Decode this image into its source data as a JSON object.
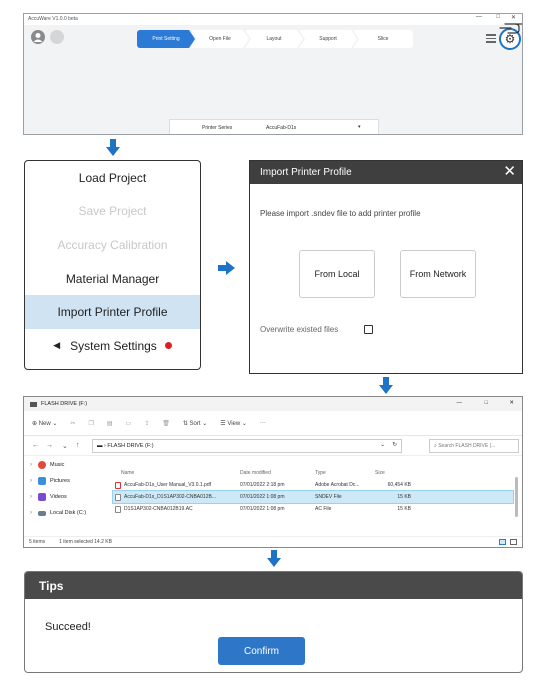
{
  "app": {
    "title": "AccuWare V1.0.0 beta",
    "tabs": [
      "Print Setting",
      "Open File",
      "Layout",
      "Support",
      "Slice"
    ],
    "active_tab": "Print Setting",
    "printer_series_label": "Printer Series",
    "printer_series_value": "AccuFab-D1s",
    "window_controls": [
      "—",
      "□",
      "✕"
    ]
  },
  "menu": {
    "items": [
      {
        "label": "Load Project",
        "state": "normal"
      },
      {
        "label": "Save Project",
        "state": "disabled"
      },
      {
        "label": "Accuracy Calibration",
        "state": "disabled"
      },
      {
        "label": "Material Manager",
        "state": "normal"
      },
      {
        "label": "Import Printer Profile",
        "state": "selected"
      },
      {
        "label": "System Settings",
        "state": "normal"
      }
    ],
    "expand_glyph": "◀",
    "notification_color": "#e02020"
  },
  "dialog": {
    "title": "Import Printer Profile",
    "close_glyph": "✕",
    "instruction": "Please import .sndev file to add printer profile",
    "from_local": "From Local",
    "from_network": "From Network",
    "overwrite_label": "Overwrite existed files"
  },
  "explorer": {
    "title": "FLASH DRIVE (F:)",
    "toolbar": {
      "new": "New",
      "sort": "Sort",
      "view": "View",
      "more": "···"
    },
    "address": "FLASH DRIVE (F:)",
    "search_placeholder": "Search FLASH DRIVE (...",
    "sidebar": [
      "Music",
      "Pictures",
      "Videos",
      "Local Disk (C:)"
    ],
    "columns": {
      "name": "Name",
      "date": "Date modified",
      "type": "Type",
      "size": "Size"
    },
    "files": [
      {
        "name": "AccuFab-D1s_User Manual_V3.0.1.pdf",
        "date": "07/01/2022 2:18 pm",
        "type": "Adobe Acrobat Dc...",
        "size": "60,454 KB",
        "icon": "pdf-icon"
      },
      {
        "name": "AccuFab-D1s_D1S1AP302-CNBA012B...",
        "date": "07/01/2022 1:08 pm",
        "type": "SNDEV File",
        "size": "15 KB",
        "icon": "file-icon"
      },
      {
        "name": "D1S1AP302-CNBA012B19.AC",
        "date": "07/01/2022 1:08 pm",
        "type": "AC File",
        "size": "15 KB",
        "icon": "file-icon"
      }
    ],
    "selected_index": 1,
    "status_items": "5 items",
    "status_selected": "1 item selected  14.2 KB",
    "window_controls": [
      "—",
      "□",
      "✕"
    ]
  },
  "tips": {
    "title": "Tips",
    "message": "Succeed!",
    "confirm": "Confirm"
  },
  "colors": {
    "accent": "#2a7ad6",
    "arrow": "#1f73c6",
    "dialog_header": "#3f3f3f",
    "tips_header": "#4a4a4a",
    "selected_row": "#cde8f7",
    "selected_menu": "#cfe3f3"
  }
}
